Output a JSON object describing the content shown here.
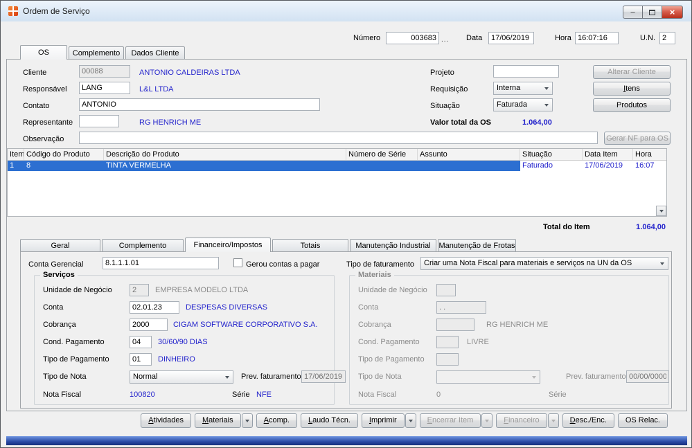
{
  "colors": {
    "link_blue": "#2323cc",
    "selection_blue": "#2c6fd1",
    "disabled_text": "#8b8b8b",
    "footer_strip": "#16307c"
  },
  "icons": {
    "app": "app-grid-icon",
    "maximize": "window-restore-icon",
    "dropdown": "chevron-down-icon",
    "scroll": "arrow-down-icon"
  },
  "window": {
    "title": "Ordem de Serviço",
    "minimize_glyph": "–",
    "close_glyph": "×"
  },
  "header": {
    "numero_label": "Número",
    "numero_value": "003683",
    "browse_label": "...",
    "data_label": "Data",
    "data_value": "17/06/2019",
    "hora_label": "Hora",
    "hora_value": "16:07:16",
    "un_label": "U.N.",
    "un_value": "2"
  },
  "tabs_main": {
    "os": "OS",
    "complemento": "Complemento",
    "dados_cliente": "Dados Cliente"
  },
  "form": {
    "cliente_label": "Cliente",
    "cliente_code": "00088",
    "cliente_name": "ANTONIO CALDEIRAS LTDA",
    "responsavel_label": "Responsável",
    "responsavel_code": "LANG",
    "responsavel_name": "L&L LTDA",
    "contato_label": "Contato",
    "contato_value": "ANTONIO",
    "representante_label": "Representante",
    "representante_code": "",
    "representante_name": "RG HENRICH ME",
    "observacao_label": "Observação",
    "observacao_value": "",
    "projeto_label": "Projeto",
    "projeto_value": "",
    "requisicao_label": "Requisição",
    "requisicao_value": "Interna",
    "situacao_label": "Situação",
    "situacao_value": "Faturada",
    "valor_total_label": "Valor total da OS",
    "valor_total_value": "1.064,00",
    "alterar_cliente": "Alterar Cliente",
    "itens": "Itens",
    "produtos": "Produtos",
    "gerar_nf": "Gerar NF para OS"
  },
  "grid": {
    "columns": [
      "Item",
      "Código do Produto",
      "Descrição do Produto",
      "Número de Série",
      "Assunto",
      "Situação",
      "Data Item",
      "Hora"
    ],
    "row1": {
      "item": "1",
      "codigo": "8",
      "descricao": "TINTA VERMELHA",
      "serie": "",
      "assunto": "",
      "situacao": "Faturado",
      "data_item": "17/06/2019",
      "hora": "16:07"
    },
    "total_label": "Total do Item",
    "total_value": "1.064,00"
  },
  "tabs_sub": {
    "geral": "Geral",
    "complemento": "Complemento",
    "financeiro": "Financeiro/Impostos",
    "totais": "Totais",
    "manut_industrial": "Manutenção Industrial",
    "manut_frotas": "Manutenção de Frotas"
  },
  "fin": {
    "conta_gerencial_label": "Conta Gerencial",
    "conta_gerencial_value": "8.1.1.1.01",
    "gerou_contas_label": "Gerou contas a pagar",
    "tipo_fat_label": "Tipo de faturamento",
    "tipo_fat_value": "Criar uma Nota Fiscal para materiais e serviços na UN da OS",
    "servicos": {
      "title": "Serviços",
      "un_label": "Unidade de Negócio",
      "un_code": "2",
      "un_name": "EMPRESA MODELO LTDA",
      "conta_label": "Conta",
      "conta_code": "02.01.23",
      "conta_name": "DESPESAS DIVERSAS",
      "cobranca_label": "Cobrança",
      "cobranca_code": "2000",
      "cobranca_name": "CIGAM SOFTWARE CORPORATIVO S.A.",
      "cond_label": "Cond. Pagamento",
      "cond_code": "04",
      "cond_name": "30/60/90 DIAS",
      "tipo_pag_label": "Tipo de Pagamento",
      "tipo_pag_code": "01",
      "tipo_pag_name": "DINHEIRO",
      "tipo_nota_label": "Tipo de Nota",
      "tipo_nota_value": "Normal",
      "prev_label": "Prev. faturamento",
      "prev_value": "17/06/2019",
      "nf_label": "Nota Fiscal",
      "nf_value": "100820",
      "serie_label": "Série",
      "serie_value": "NFE"
    },
    "materiais": {
      "title": "Materiais",
      "un_label": "Unidade de Negócio",
      "un_code": "",
      "conta_label": "Conta",
      "conta_code": ". .",
      "cobranca_label": "Cobrança",
      "cobranca_code": "",
      "cobranca_name": "RG HENRICH ME",
      "cond_label": "Cond. Pagamento",
      "cond_code": "",
      "cond_name": "LIVRE",
      "tipo_pag_label": "Tipo de Pagamento",
      "tipo_pag_code": "",
      "tipo_nota_label": "Tipo de Nota",
      "tipo_nota_value": "",
      "prev_label": "Prev. faturamento",
      "prev_value": "00/00/0000",
      "nf_label": "Nota Fiscal",
      "nf_value": "0",
      "serie_label": "Série",
      "serie_value": ""
    }
  },
  "footer": {
    "atividades": "Atividades",
    "materiais": "Materiais",
    "acomp": "Acomp.",
    "laudo": "Laudo Técn.",
    "imprimir": "Imprimir",
    "encerrar": "Encerrar Item",
    "financeiro": "Financeiro",
    "desc_enc": "Desc./Enc.",
    "os_relac": "OS Relac."
  }
}
